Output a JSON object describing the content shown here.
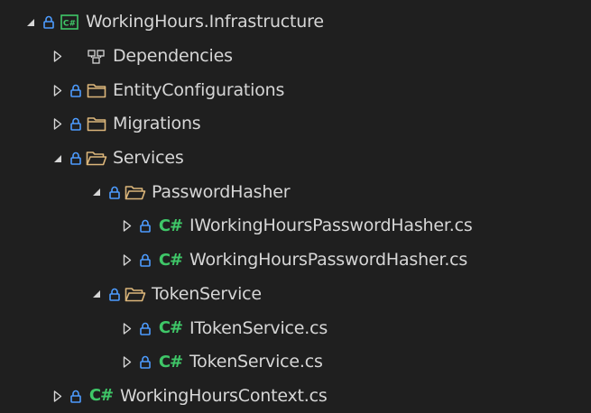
{
  "colors": {
    "background": "#1f1f1f",
    "text": "#d6d6d6",
    "lock": "#4d9cff",
    "folder": "#dcb67a",
    "csharp": "#3fc768",
    "chevron": "#d6d6d6"
  },
  "icons": {
    "cs_glyph": "C#"
  },
  "tree": [
    {
      "label": "WorkingHours.Infrastructure",
      "expanded": true,
      "icon": "csharp-project-icon"
    },
    {
      "label": "Dependencies",
      "expanded": false,
      "icon": "dependencies-icon"
    },
    {
      "label": "EntityConfigurations",
      "expanded": false,
      "icon": "folder-icon"
    },
    {
      "label": "Migrations",
      "expanded": false,
      "icon": "folder-icon"
    },
    {
      "label": "Services",
      "expanded": true,
      "icon": "folder-open-icon"
    },
    {
      "label": "PasswordHasher",
      "expanded": true,
      "icon": "folder-open-icon"
    },
    {
      "label": "IWorkingHoursPasswordHasher.cs",
      "expanded": false,
      "icon": "csharp-file-icon"
    },
    {
      "label": "WorkingHoursPasswordHasher.cs",
      "expanded": false,
      "icon": "csharp-file-icon"
    },
    {
      "label": "TokenService",
      "expanded": true,
      "icon": "folder-open-icon"
    },
    {
      "label": "ITokenService.cs",
      "expanded": false,
      "icon": "csharp-file-icon"
    },
    {
      "label": "TokenService.cs",
      "expanded": false,
      "icon": "csharp-file-icon"
    },
    {
      "label": "WorkingHoursContext.cs",
      "expanded": false,
      "icon": "csharp-file-icon"
    }
  ]
}
